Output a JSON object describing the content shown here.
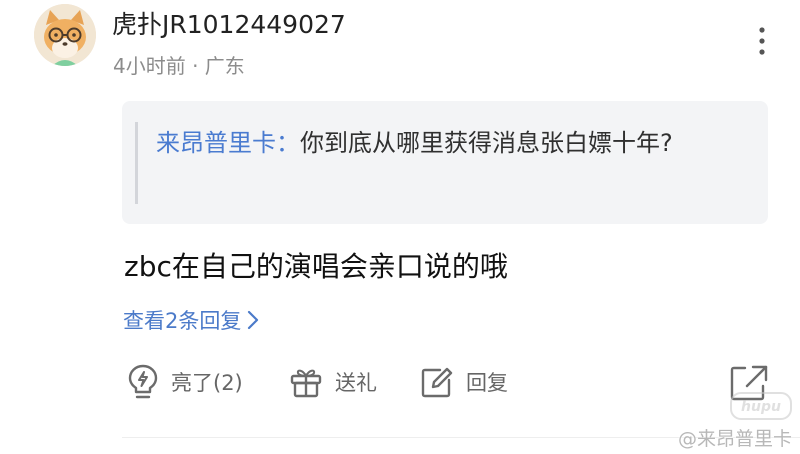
{
  "post": {
    "username": "虎扑JR1012449027",
    "meta": "4小时前 · 广东",
    "quote": {
      "author": "来昂普里卡：",
      "text": "你到底从哪里获得消息张白嫖十年?"
    },
    "comment": "zbc在自己的演唱会亲口说的哦",
    "view_replies": "查看2条回复"
  },
  "actions": {
    "like": "亮了(2)",
    "gift": "送礼",
    "reply": "回复"
  },
  "watermark": {
    "text": "@来昂普里卡",
    "logo_text": "hupu"
  },
  "icons": {
    "avatar": "avatar-fox-glasses",
    "more": "more-vertical-icon",
    "chevron": "chevron-right-icon",
    "like": "lightning-bulb-icon",
    "gift": "gift-icon",
    "reply": "edit-icon",
    "share": "share-icon"
  },
  "colors": {
    "accent": "#4b7ac9",
    "quote_bg": "#f3f4f6",
    "muted": "#8c8c8c"
  }
}
